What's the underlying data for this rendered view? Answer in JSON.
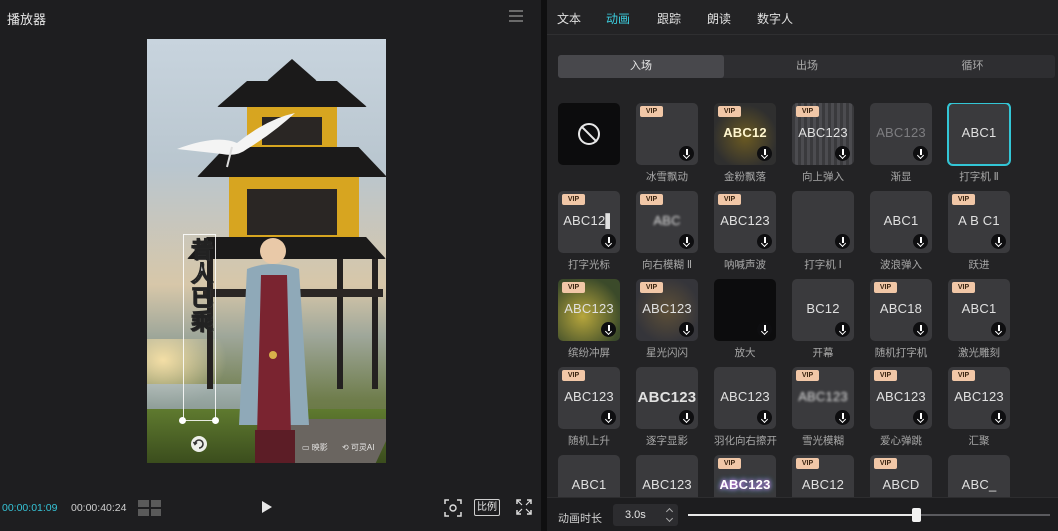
{
  "player": {
    "title": "播放器",
    "overlay_text": "昔人已乘",
    "watermark_left": "▭ 映影",
    "watermark_right": "⟲ 可灵AI",
    "current_time": "00:00:01:09",
    "total_time": "00:00:40:24",
    "ratio_label": "比例"
  },
  "tabs": [
    {
      "label": "文本",
      "active": false
    },
    {
      "label": "动画",
      "active": true
    },
    {
      "label": "跟踪",
      "active": false
    },
    {
      "label": "朗读",
      "active": false
    },
    {
      "label": "数字人",
      "active": false
    }
  ],
  "segments": [
    {
      "label": "入场",
      "active": true
    },
    {
      "label": "出场",
      "active": false
    },
    {
      "label": "循环",
      "active": false
    }
  ],
  "vip_badge": "VIP",
  "animations": [
    {
      "label": "",
      "thumb": "",
      "vip": false,
      "type": "none"
    },
    {
      "label": "冰雪飘动",
      "thumb": "",
      "vip": true
    },
    {
      "label": "金粉飘落",
      "thumb": "ABC12",
      "vip": true,
      "type": "gold"
    },
    {
      "label": "向上弹入",
      "thumb": "ABC123",
      "vip": true,
      "type": "bars"
    },
    {
      "label": "渐显",
      "thumb": "ABC123",
      "vip": false,
      "type": "fade"
    },
    {
      "label": "打字机 Ⅱ",
      "thumb": "ABC1",
      "vip": false,
      "type": "selected"
    },
    {
      "label": "打字光标",
      "thumb": "ABC12▌",
      "vip": true
    },
    {
      "label": "向右模糊 Ⅱ",
      "thumb": "ABC",
      "vip": true,
      "type": "blur"
    },
    {
      "label": "呐喊声波",
      "thumb": "ABC123",
      "vip": true
    },
    {
      "label": "打字机 Ⅰ",
      "thumb": "",
      "vip": false
    },
    {
      "label": "波浪弹入",
      "thumb": "ABC1",
      "vip": false
    },
    {
      "label": "跃进",
      "thumb": "A B C1",
      "vip": true
    },
    {
      "label": "缤纷冲屏",
      "thumb": "ABC123",
      "vip": true,
      "type": "burst"
    },
    {
      "label": "星光闪闪",
      "thumb": "ABC123",
      "vip": true,
      "type": "stars"
    },
    {
      "label": "放大",
      "thumb": "",
      "vip": false,
      "type": "black"
    },
    {
      "label": "开幕",
      "thumb": "BC12",
      "vip": false
    },
    {
      "label": "随机打字机",
      "thumb": "ABC18",
      "vip": true
    },
    {
      "label": "激光雕刻",
      "thumb": "ABC1",
      "vip": true
    },
    {
      "label": "随机上升",
      "thumb": "ABC123",
      "vip": true
    },
    {
      "label": "逐字显影",
      "thumb": "ABC123",
      "vip": false,
      "type": "bold"
    },
    {
      "label": "羽化向右擦开",
      "thumb": "ABC123",
      "vip": false
    },
    {
      "label": "雪光模糊",
      "thumb": "ABC123",
      "vip": true,
      "type": "blur"
    },
    {
      "label": "爱心弹跳",
      "thumb": "ABC123",
      "vip": true
    },
    {
      "label": "汇聚",
      "thumb": "ABC123",
      "vip": true
    },
    {
      "label": "",
      "thumb": "ABC1",
      "vip": false
    },
    {
      "label": "",
      "thumb": "ABC123",
      "vip": false
    },
    {
      "label": "",
      "thumb": "ABC123",
      "vip": true,
      "type": "neon"
    },
    {
      "label": "",
      "thumb": "ABC12",
      "vip": true
    },
    {
      "label": "",
      "thumb": "ABCD",
      "vip": true
    },
    {
      "label": "",
      "thumb": "ABC_",
      "vip": false
    }
  ],
  "duration": {
    "label": "动画时长",
    "value": "3.0s",
    "slider_fraction": 0.63
  },
  "colors": {
    "accent": "#3ccfe0",
    "vip_bg": "#f1c7a7"
  },
  "icons": [
    "menu-icon",
    "rotate-icon",
    "grid-icon",
    "play-icon",
    "focus-icon",
    "fullscreen-icon",
    "download-icon",
    "none-icon",
    "stepper-icon"
  ]
}
